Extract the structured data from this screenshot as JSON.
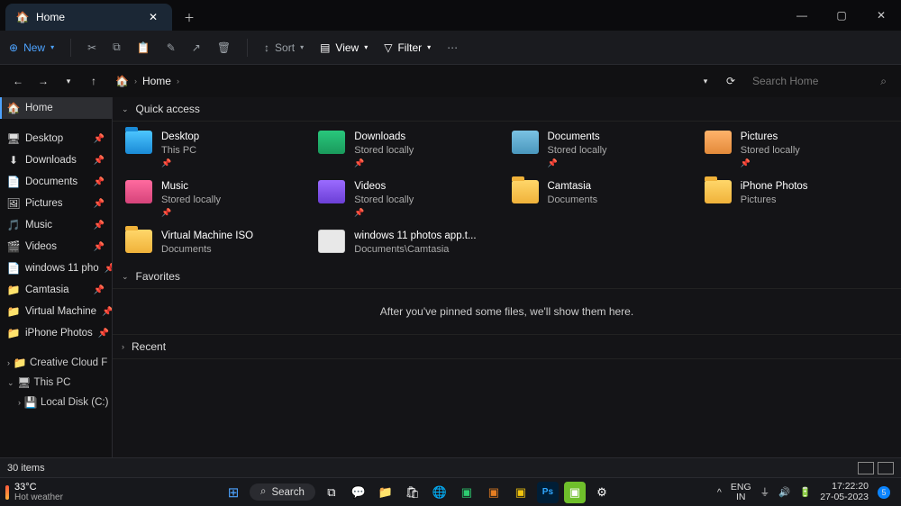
{
  "titlebar": {
    "tab_title": "Home"
  },
  "toolbar": {
    "new": "New",
    "sort": "Sort",
    "view": "View",
    "filter": "Filter"
  },
  "breadcrumb": {
    "location": "Home"
  },
  "search": {
    "placeholder": "Search Home"
  },
  "sidebar": {
    "home": "Home",
    "pinned": [
      {
        "label": "Desktop"
      },
      {
        "label": "Downloads"
      },
      {
        "label": "Documents"
      },
      {
        "label": "Pictures"
      },
      {
        "label": "Music"
      },
      {
        "label": "Videos"
      },
      {
        "label": "windows 11 pho"
      },
      {
        "label": "Camtasia"
      },
      {
        "label": "Virtual Machine"
      },
      {
        "label": "iPhone Photos"
      }
    ],
    "creative": "Creative Cloud F",
    "thispc": "This PC",
    "localdisk": "Local Disk (C:)"
  },
  "content": {
    "quick_access_header": "Quick access",
    "favorites_header": "Favorites",
    "favorites_empty": "After you've pinned some files, we'll show them here.",
    "recent_header": "Recent",
    "items": [
      {
        "name": "Desktop",
        "sub": "This PC",
        "pinned": true
      },
      {
        "name": "Downloads",
        "sub": "Stored locally",
        "pinned": true
      },
      {
        "name": "Documents",
        "sub": "Stored locally",
        "pinned": true
      },
      {
        "name": "Pictures",
        "sub": "Stored locally",
        "pinned": true
      },
      {
        "name": "Music",
        "sub": "Stored locally",
        "pinned": true
      },
      {
        "name": "Videos",
        "sub": "Stored locally",
        "pinned": true
      },
      {
        "name": "Camtasia",
        "sub": "Documents",
        "pinned": false
      },
      {
        "name": "iPhone Photos",
        "sub": "Pictures",
        "pinned": false
      },
      {
        "name": "Virtual Machine ISO",
        "sub": "Documents",
        "pinned": false
      },
      {
        "name": "windows 11 photos app.t...",
        "sub": "Documents\\Camtasia",
        "pinned": false
      }
    ]
  },
  "status": {
    "count": "30 items"
  },
  "taskbar": {
    "temp": "33°C",
    "weather": "Hot weather",
    "search": "Search",
    "lang1": "ENG",
    "lang2": "IN",
    "time": "17:22:20",
    "date": "27-05-2023",
    "notif": "5"
  }
}
